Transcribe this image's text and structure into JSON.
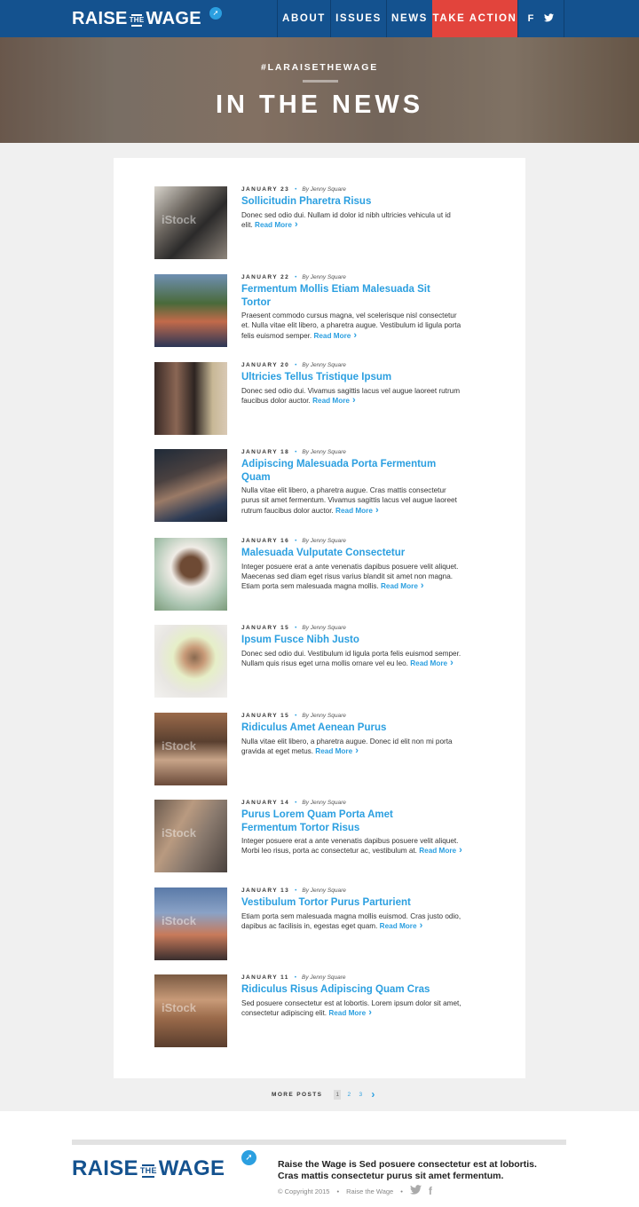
{
  "nav": {
    "logo": {
      "raise": "RAISE",
      "the": "THE",
      "wage": "WAGE"
    },
    "items": [
      "ABOUT",
      "ISSUES",
      "NEWS",
      "TAKE ACTION"
    ],
    "social": [
      "f",
      "t"
    ]
  },
  "hero": {
    "hashtag": "#LARAISETHEWAGE",
    "title": "IN THE NEWS"
  },
  "posts": [
    {
      "date": "JANUARY 23",
      "author": "By Jenny Square",
      "title": "Sollicitudin Pharetra Risus",
      "excerpt": "Donec sed odio dui. Nullam id dolor id nibh ultricies vehicula ut id elit.",
      "read_more": "Read More"
    },
    {
      "date": "JANUARY 22",
      "author": "By Jenny Square",
      "title": "Fermentum Mollis Etiam Malesuada Sit Tortor",
      "excerpt": "Praesent commodo cursus magna, vel scelerisque nisl consectetur et. Nulla vitae elit libero, a pharetra augue. Vestibulum id ligula porta felis euismod semper.",
      "read_more": "Read More"
    },
    {
      "date": "JANUARY 20",
      "author": "By Jenny Square",
      "title": "Ultricies Tellus Tristique Ipsum",
      "excerpt": "Donec sed odio dui. Vivamus sagittis lacus vel augue laoreet rutrum faucibus dolor auctor.",
      "read_more": "Read More"
    },
    {
      "date": "JANUARY 18",
      "author": "By Jenny Square",
      "title": "Adipiscing Malesuada Porta Fermentum Quam",
      "excerpt": "Nulla vitae elit libero, a pharetra augue. Cras mattis consectetur purus sit amet fermentum. Vivamus sagittis lacus vel augue laoreet rutrum faucibus dolor auctor.",
      "read_more": "Read More"
    },
    {
      "date": "JANUARY 16",
      "author": "By Jenny Square",
      "title": "Malesuada Vulputate Consectetur",
      "excerpt": "Integer posuere erat a ante venenatis dapibus posuere velit aliquet. Maecenas sed diam eget risus varius blandit sit amet non magna. Etiam porta sem malesuada magna mollis.",
      "read_more": "Read More"
    },
    {
      "date": "JANUARY 15",
      "author": "By Jenny Square",
      "title": "Ipsum Fusce Nibh Justo",
      "excerpt": "Donec sed odio dui. Vestibulum id ligula porta felis euismod semper. Nullam quis risus eget urna mollis ornare vel eu leo.",
      "read_more": "Read More"
    },
    {
      "date": "JANUARY 15",
      "author": "By Jenny Square",
      "title": "Ridiculus Amet Aenean Purus",
      "excerpt": "Nulla vitae elit libero, a pharetra augue. Donec id elit non mi porta gravida at eget metus.",
      "read_more": "Read More"
    },
    {
      "date": "JANUARY 14",
      "author": "By Jenny Square",
      "title": "Purus Lorem Quam Porta Amet Fermentum Tortor Risus",
      "excerpt": "Integer posuere erat a ante venenatis dapibus posuere velit aliquet. Morbi leo risus, porta ac consectetur ac, vestibulum at.",
      "read_more": "Read More"
    },
    {
      "date": "JANUARY 13",
      "author": "By Jenny Square",
      "title": "Vestibulum Tortor Purus Parturient",
      "excerpt": "Etiam porta sem malesuada magna mollis euismod. Cras justo odio, dapibus ac facilisis in, egestas eget quam.",
      "read_more": "Read More"
    },
    {
      "date": "JANUARY 11",
      "author": "By Jenny Square",
      "title": "Ridiculus Risus Adipiscing Quam Cras",
      "excerpt": "Sed posuere consectetur est at lobortis. Lorem ipsum dolor sit amet, consectetur adipiscing elit.",
      "read_more": "Read More"
    }
  ],
  "thumb_watermarks": [
    "iStock",
    "",
    "",
    "",
    "",
    "",
    "iStock",
    "iStock",
    "iStock",
    "iStock"
  ],
  "pagination": {
    "label": "MORE POSTS",
    "pages": [
      "1",
      "2",
      "3"
    ],
    "current": "1"
  },
  "footer": {
    "logo": {
      "raise": "RAISE",
      "the": "THE",
      "wage": "WAGE"
    },
    "description": "Raise the Wage is Sed posuere consectetur est at lobortis. Cras mattis consectetur purus sit amet fermentum.",
    "copyright": "© Copyright 2015",
    "site_name": "Raise the Wage",
    "social_icons": [
      "twitter-icon",
      "facebook-icon"
    ]
  },
  "colors": {
    "nav": "#14528f",
    "accent": "#2b9fe0",
    "take_action": "#e2443c"
  }
}
